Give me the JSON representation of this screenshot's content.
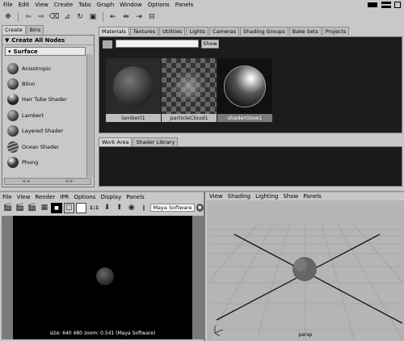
{
  "main_menu": [
    "File",
    "Edit",
    "View",
    "Create",
    "Tabs",
    "Graph",
    "Window",
    "Options",
    "Panels"
  ],
  "left_panel": {
    "tabs": [
      "Create",
      "Bins"
    ],
    "create_all": "Create All Nodes",
    "section": "Surface",
    "nodes": [
      "Anisotropic",
      "Blinn",
      "Hair Tube Shader",
      "Lambert",
      "Layered Shader",
      "Ocean Shader",
      "Phong"
    ],
    "scroll_left": "<<",
    "scroll_right": ">>"
  },
  "hypershade": {
    "tabs": [
      "Materials",
      "Textures",
      "Utilities",
      "Lights",
      "Cameras",
      "Shading Groups",
      "Bake Sets",
      "Projects"
    ],
    "show_button": "Show",
    "swatches": [
      "lambert1",
      "particleCloud1",
      "shaderGlow1"
    ],
    "selected_swatch": "shaderGlow1"
  },
  "work_area": {
    "tabs": [
      "Work Area",
      "Shader Library"
    ]
  },
  "render_view": {
    "menu": [
      "File",
      "View",
      "Render",
      "IPR",
      "Options",
      "Display",
      "Panels"
    ],
    "ratio": "1:1",
    "renderer": "Maya Software",
    "status": "size:  640  480  zoom:  0.541   (Maya Software)"
  },
  "persp_panel": {
    "menu": [
      "View",
      "Shading",
      "Lighting",
      "Show",
      "Panels"
    ],
    "camera_label": "persp"
  }
}
